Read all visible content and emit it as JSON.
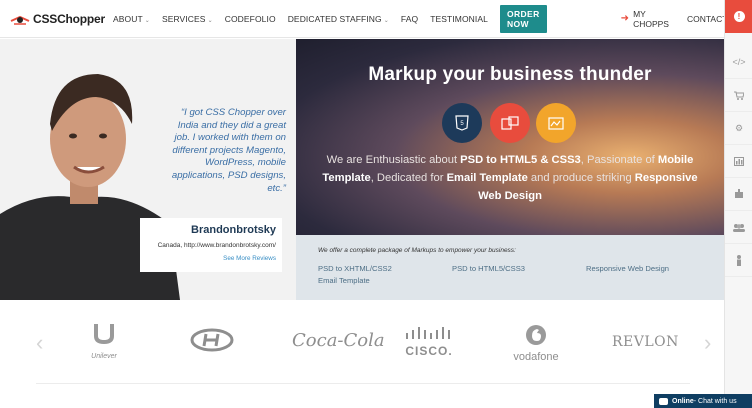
{
  "brand": {
    "logo_text": "CSSChopper"
  },
  "nav": {
    "items": [
      {
        "label": "ABOUT",
        "dropdown": true
      },
      {
        "label": "SERVICES",
        "dropdown": true
      },
      {
        "label": "CODEFOLIO",
        "dropdown": false
      },
      {
        "label": "DEDICATED STAFFING",
        "dropdown": true
      },
      {
        "label": "FAQ",
        "dropdown": false
      },
      {
        "label": "TESTIMONIAL",
        "dropdown": false
      }
    ],
    "order_now": "ORDER NOW",
    "my_chopps": "MY CHOPPS",
    "contact": "CONTACT"
  },
  "testimonial": {
    "quote": "“I got CSS Chopper over India and they did a great job. I worked with them on different projects Magento, WordPress, mobile applications, PSD designs, etc.”",
    "name": "Brandonbrotsky",
    "location": "Canada, http://www.brandonbrotsky.com/",
    "see_more": "See More Reviews"
  },
  "hero": {
    "title": "Markup your business thunder",
    "desc_parts": [
      "We are Enthusiastic about ",
      "PSD to HTML5 & CSS3",
      ", Passionate of ",
      "Mobile Template",
      ", Dedicated for ",
      "Email Template",
      " and produce striking ",
      "Responsive Web Design"
    ]
  },
  "offer": {
    "heading": "We offer a complete package of Markups to empower your business:",
    "links": [
      "PSD to XHTML/CSS2",
      "PSD to HTML5/CSS3",
      "Responsive Web Design",
      "Email Template"
    ]
  },
  "clients": [
    "Unilever",
    "Hyundai",
    "Coca-Cola",
    "CISCO.",
    "vodafone",
    "REVLON"
  ],
  "chat": {
    "status": "Online",
    "text": " - Chat with us"
  },
  "colors": {
    "accent_red": "#e84c3d",
    "teal": "#1e8c8c",
    "navy": "#1d3a5a",
    "orange": "#f2a52b"
  },
  "rail_icons": [
    "alert-icon",
    "code-icon",
    "cart-icon",
    "gear-icon",
    "chart-icon",
    "robot-icon",
    "team-icon",
    "person-icon"
  ]
}
